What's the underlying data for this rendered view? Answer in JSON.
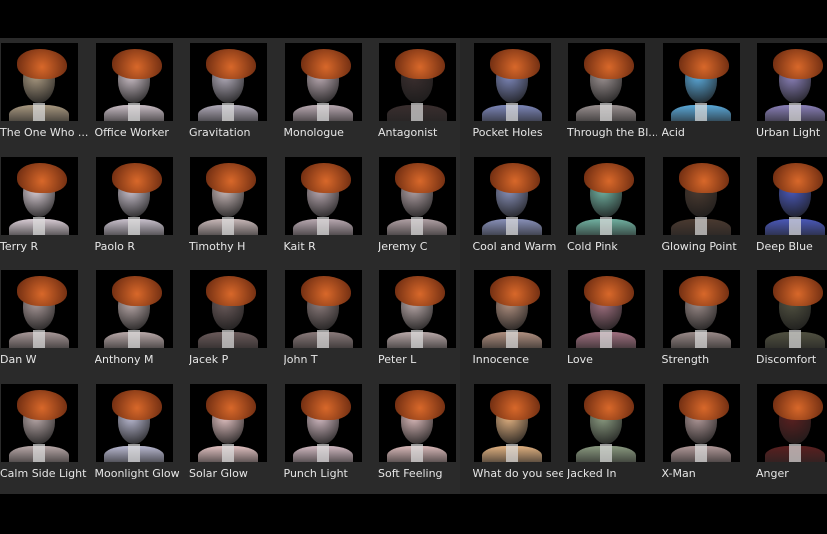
{
  "asset_browser": {
    "items": [
      {
        "label": "The One Who ...",
        "tint": "#a89880"
      },
      {
        "label": "Office Worker",
        "tint": "#c8bcc4"
      },
      {
        "label": "Gravitation",
        "tint": "#b0aab8"
      },
      {
        "label": "Monologue",
        "tint": "#b8a8b0"
      },
      {
        "label": "Antagonist",
        "tint": "#3a2e2e"
      },
      {
        "label": "Pocket Holes",
        "tint": "#7c86b8"
      },
      {
        "label": "Through the Bl...",
        "tint": "#9a9090"
      },
      {
        "label": "Acid",
        "tint": "#5aa8d8"
      },
      {
        "label": "Urban Light",
        "tint": "#8a80b8"
      },
      {
        "label": "Terry R",
        "tint": "#d8ccd4"
      },
      {
        "label": "Paolo R",
        "tint": "#c8c0cc"
      },
      {
        "label": "Timothy H",
        "tint": "#c8b8b8"
      },
      {
        "label": "Kait R",
        "tint": "#b8a8b0"
      },
      {
        "label": "Jeremy C",
        "tint": "#b0a0a4"
      },
      {
        "label": "Cool and Warm",
        "tint": "#8890b8"
      },
      {
        "label": "Cold Pink",
        "tint": "#70b0a0"
      },
      {
        "label": "Glowing Point",
        "tint": "#4a3a30"
      },
      {
        "label": "Deep Blue",
        "tint": "#4a58b8"
      },
      {
        "label": "Dan W",
        "tint": "#a89898"
      },
      {
        "label": "Anthony M",
        "tint": "#b8a8a8"
      },
      {
        "label": "Jacek P",
        "tint": "#6a5a5a"
      },
      {
        "label": "John T",
        "tint": "#8a7a7a"
      },
      {
        "label": "Peter L",
        "tint": "#b8a8a8"
      },
      {
        "label": "Innocence",
        "tint": "#b09080"
      },
      {
        "label": "Love",
        "tint": "#a07080"
      },
      {
        "label": "Strength",
        "tint": "#9a8a88"
      },
      {
        "label": "Discomfort",
        "tint": "#505040"
      },
      {
        "label": "Calm Side Light",
        "tint": "#b8a8a8"
      },
      {
        "label": "Moonlight Glow",
        "tint": "#b8b8d0"
      },
      {
        "label": "Solar Glow",
        "tint": "#e0c0c0"
      },
      {
        "label": "Punch Light",
        "tint": "#d0b8c0"
      },
      {
        "label": "Soft Feeling",
        "tint": "#d8b8b8"
      },
      {
        "label": "What do you see",
        "tint": "#e0b080"
      },
      {
        "label": "Jacked In",
        "tint": "#8a9a80"
      },
      {
        "label": "X-Man",
        "tint": "#b09898"
      },
      {
        "label": "Anger",
        "tint": "#5a2020"
      }
    ],
    "hair_color": "#d8682a"
  }
}
